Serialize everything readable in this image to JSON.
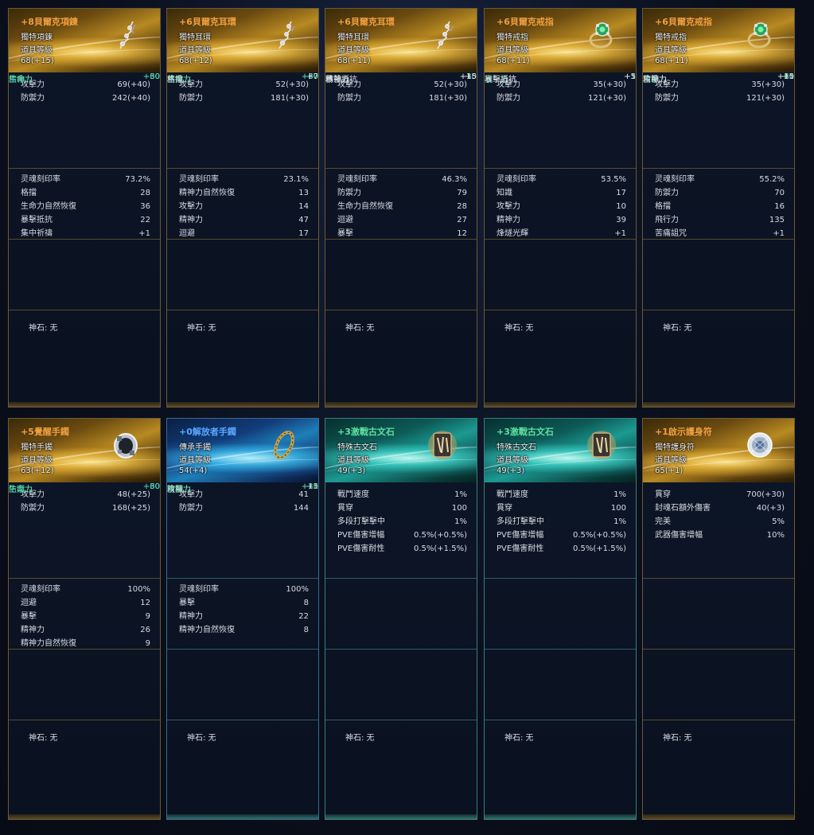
{
  "cards": [
    {
      "name": "+8貝爾克項鍊",
      "name_color": "orange",
      "theme": "gold",
      "type": "獨特項鍊",
      "level_label": "道具等級",
      "level": "68(+15)",
      "icon": "necklace-icon",
      "base": [
        [
          "攻擊力",
          "69(+40)"
        ],
        [
          "防禦力",
          "242(+40)"
        ]
      ],
      "soul": [
        [
          "灵魂刻印率",
          "73.2%"
        ],
        [
          "格擋",
          "28"
        ],
        [
          "生命力自然恢復",
          "36"
        ],
        [
          "暴擊抵抗",
          "22"
        ],
        [
          "集中祈禱",
          "+1"
        ]
      ],
      "bonus": [
        [
          "生命力",
          "+60",
          "green"
        ],
        [
          "生命力",
          "+30",
          "white"
        ],
        [
          "生命力",
          "+60",
          "green"
        ],
        [
          "精神力",
          "+30",
          "green"
        ]
      ],
      "stone": "神石: 无"
    },
    {
      "name": "+6貝爾克耳環",
      "name_color": "orange",
      "theme": "gold",
      "type": "獨特耳環",
      "level_label": "道具等級",
      "level": "68(+12)",
      "icon": "earring-icon",
      "base": [
        [
          "攻擊力",
          "52(+30)"
        ],
        [
          "防禦力",
          "181(+30)"
        ]
      ],
      "soul": [
        [
          "灵魂刻印率",
          "23.1%"
        ],
        [
          "精神力自然恢復",
          "13"
        ],
        [
          "攻擊力",
          "14"
        ],
        [
          "精神力",
          "47"
        ],
        [
          "迴避",
          "17"
        ]
      ],
      "bonus": [
        [
          "精神力",
          "+30",
          "green"
        ],
        [
          "生命力",
          "+30",
          "white"
        ],
        [
          "生命力",
          "+60",
          "green"
        ],
        [
          "格擋",
          "+7",
          "white"
        ]
      ],
      "stone": "神石: 无"
    },
    {
      "name": "+6貝爾克耳環",
      "name_color": "orange",
      "theme": "gold",
      "type": "獨特耳環",
      "level_label": "道具等級",
      "level": "68(+11)",
      "icon": "earring-icon",
      "base": [
        [
          "攻擊力",
          "52(+30)"
        ],
        [
          "防禦力",
          "181(+30)"
        ]
      ],
      "soul": [
        [
          "灵魂刻印率",
          "46.3%"
        ],
        [
          "防禦力",
          "79"
        ],
        [
          "生命力自然恢復",
          "28"
        ],
        [
          "迴避",
          "27"
        ],
        [
          "暴擊",
          "12"
        ]
      ],
      "bonus": [
        [
          "精神力",
          "+30",
          "green"
        ],
        [
          "精神力",
          "+15",
          "white"
        ],
        [
          "精神力",
          "+15",
          "white"
        ],
        [
          "暴擊抵抗",
          "+5",
          "white"
        ]
      ],
      "stone": "神石: 无"
    },
    {
      "name": "+6貝爾克戒指",
      "name_color": "orange",
      "theme": "gold",
      "type": "獨特戒指",
      "level_label": "道具等級",
      "level": "68(+11)",
      "icon": "ring-icon",
      "base": [
        [
          "攻擊力",
          "35(+30)"
        ],
        [
          "防禦力",
          "121(+30)"
        ]
      ],
      "soul": [
        [
          "灵魂刻印率",
          "53.5%"
        ],
        [
          "知識",
          "17"
        ],
        [
          "攻擊力",
          "10"
        ],
        [
          "精神力",
          "39"
        ],
        [
          "烽燧光輝",
          "+1"
        ]
      ],
      "bonus": [
        [
          "暴擊抵抗",
          "+5",
          "white"
        ],
        [
          "攻擊力",
          "+1",
          "white"
        ],
        [
          "攻擊力",
          "+3",
          "green"
        ],
        [
          "暴擊抵抗",
          "+5",
          "white"
        ]
      ],
      "stone": "神石: 无"
    },
    {
      "name": "+6貝爾克戒指",
      "name_color": "orange",
      "theme": "gold",
      "type": "獨特戒指",
      "level_label": "道具等級",
      "level": "68(+11)",
      "icon": "ring-icon",
      "base": [
        [
          "攻擊力",
          "35(+30)"
        ],
        [
          "防禦力",
          "121(+30)"
        ]
      ],
      "soul": [
        [
          "灵魂刻印率",
          "55.2%"
        ],
        [
          "防禦力",
          "70"
        ],
        [
          "格擋",
          "16"
        ],
        [
          "飛行力",
          "135"
        ],
        [
          "苦痛詛咒",
          "+1"
        ]
      ],
      "bonus": [
        [
          "攻擊力",
          "+1",
          "white"
        ],
        [
          "生命力",
          "+30",
          "white"
        ],
        [
          "生命力",
          "+60",
          "green"
        ],
        [
          "精神力",
          "+15",
          "white"
        ]
      ],
      "stone": "神石: 无"
    },
    {
      "name": "+5覺醒手鐲",
      "name_color": "orange",
      "theme": "gold",
      "type": "獨特手鐲",
      "level_label": "道具等級",
      "level": "63(+12)",
      "icon": "bracelet-icon",
      "base": [
        [
          "攻擊力",
          "48(+25)"
        ],
        [
          "防禦力",
          "168(+25)"
        ]
      ],
      "soul": [
        [
          "灵魂刻印率",
          "100%"
        ],
        [
          "迴避",
          "12"
        ],
        [
          "暴擊",
          "9"
        ],
        [
          "精神力",
          "26"
        ],
        [
          "精神力自然恢復",
          "9"
        ]
      ],
      "bonus": [
        [
          "生命力",
          "+30",
          "white"
        ],
        [
          "生命力",
          "+60",
          "green"
        ],
        [
          "防禦力",
          "+30",
          "green"
        ],
        [
          "生命力",
          "+60",
          "green"
        ]
      ],
      "stone": "神石: 无"
    },
    {
      "name": "+0解放者手鐲",
      "name_color": "blue",
      "theme": "blue",
      "type": "傳承手鐲",
      "level_label": "道具等級",
      "level": "54(+4)",
      "icon": "bangle-icon",
      "base": [
        [
          "攻擊力",
          "41"
        ],
        [
          "防禦力",
          "144"
        ]
      ],
      "soul": [
        [
          "灵魂刻印率",
          "100%"
        ],
        [
          "暴擊",
          "8"
        ],
        [
          "精神力",
          "22"
        ],
        [
          "精神力自然恢復",
          "8"
        ]
      ],
      "bonus": [
        [
          "精神力",
          "+15",
          "white"
        ],
        [
          "攻擊力",
          "+1",
          "white"
        ],
        [
          "防禦力",
          "+30",
          "green"
        ]
      ],
      "stone": "神石: 无"
    },
    {
      "name": "+3激戰古文石",
      "name_color": "green",
      "theme": "teal",
      "type": "特殊古文石",
      "level_label": "道具等級",
      "level": "49(+3)",
      "icon": "rune-stone-icon",
      "base": [
        [
          "戰鬥速度",
          "1%"
        ],
        [
          "貫穿",
          "100"
        ],
        [
          "多段打擊擊中",
          "1%"
        ],
        [
          "PVE傷害增幅",
          "0.5%(+0.5%)"
        ],
        [
          "PVE傷害耐性",
          "0.5%(+1.5%)"
        ]
      ],
      "soul": [],
      "bonus": [],
      "stone": "神石: 无"
    },
    {
      "name": "+3激戰古文石",
      "name_color": "green",
      "theme": "teal",
      "type": "特殊古文石",
      "level_label": "道具等級",
      "level": "49(+3)",
      "icon": "rune-stone-icon",
      "base": [
        [
          "戰鬥速度",
          "1%"
        ],
        [
          "貫穿",
          "100"
        ],
        [
          "多段打擊擊中",
          "1%"
        ],
        [
          "PVE傷害增幅",
          "0.5%(+0.5%)"
        ],
        [
          "PVE傷害耐性",
          "0.5%(+1.5%)"
        ]
      ],
      "soul": [],
      "bonus": [],
      "stone": "神石: 无"
    },
    {
      "name": "+1啟示護身符",
      "name_color": "orange",
      "theme": "gold",
      "type": "獨特護身符",
      "level_label": "道具等級",
      "level": "65(+1)",
      "icon": "amulet-icon",
      "base": [
        [
          "貫穿",
          "700(+30)"
        ],
        [
          "封魂石額外傷害",
          "40(+3)"
        ],
        [
          "完美",
          "5%"
        ],
        [
          "武器傷害增幅",
          "10%"
        ]
      ],
      "soul": [],
      "bonus": [],
      "stone": "神石: 无"
    }
  ]
}
